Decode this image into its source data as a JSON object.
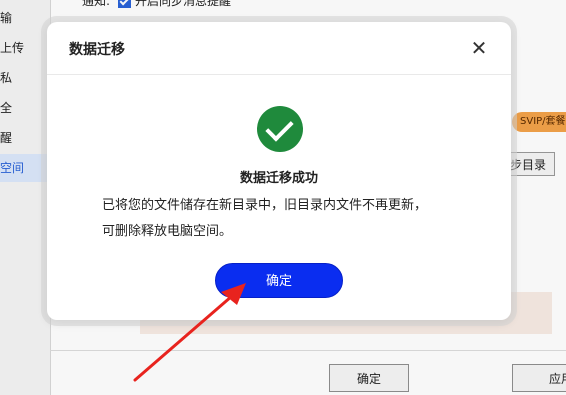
{
  "background": {
    "notify_label": "通知:",
    "notify_option": "开启同步消息提醒",
    "sidebar_items": [
      "输",
      "上传",
      "私",
      "全",
      "醒",
      "空间"
    ],
    "vip_badge": "SVIP/套餐专",
    "sync_dir_button": "步目录",
    "confirm_button": "确定",
    "apply_button": "应用"
  },
  "dialog": {
    "title": "数据迁移",
    "close_icon": "close-icon",
    "success_icon": "success-check-icon",
    "success_title": "数据迁移成功",
    "message_line1": "已将您的文件储存在新目录中，旧目录内文件不再更新，",
    "message_line2": "可删除释放电脑空间。",
    "ok_button": "确定"
  },
  "colors": {
    "accent": "#0a2df0",
    "success": "#1f8a3c",
    "annotation_arrow": "#e8231e",
    "sidebar_active": "#dbe8fb",
    "vip_badge": "#f3a34a"
  }
}
